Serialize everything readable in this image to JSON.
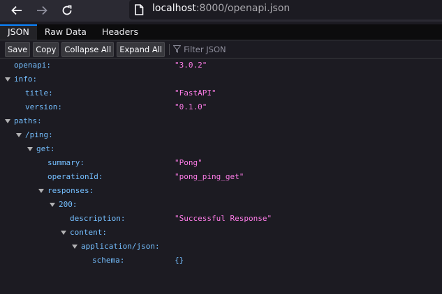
{
  "browser": {
    "url_host": "localhost",
    "url_rest": ":8000/openapi.json"
  },
  "tabs": [
    {
      "label": "JSON",
      "active": true
    },
    {
      "label": "Raw Data",
      "active": false
    },
    {
      "label": "Headers",
      "active": false
    }
  ],
  "toolbar": {
    "save_label": "Save",
    "copy_label": "Copy",
    "collapse_label": "Collapse All",
    "expand_label": "Expand All",
    "filter_placeholder": "Filter JSON"
  },
  "tree": {
    "openapi_key": "openapi:",
    "openapi_val": "\"3.0.2\"",
    "info_key": "info:",
    "title_key": "title:",
    "title_val": "\"FastAPI\"",
    "version_key": "version:",
    "version_val": "\"0.1.0\"",
    "paths_key": "paths:",
    "ping_key": "/ping:",
    "get_key": "get:",
    "summary_key": "summary:",
    "summary_val": "\"Pong\"",
    "operationId_key": "operationId:",
    "operationId_val": "\"pong_ping_get\"",
    "responses_key": "responses:",
    "code_key": "200:",
    "description_key": "description:",
    "description_val": "\"Successful Response\"",
    "content_key": "content:",
    "appjson_key": "application/json:",
    "schema_key": "schema:",
    "schema_val": "{}"
  }
}
